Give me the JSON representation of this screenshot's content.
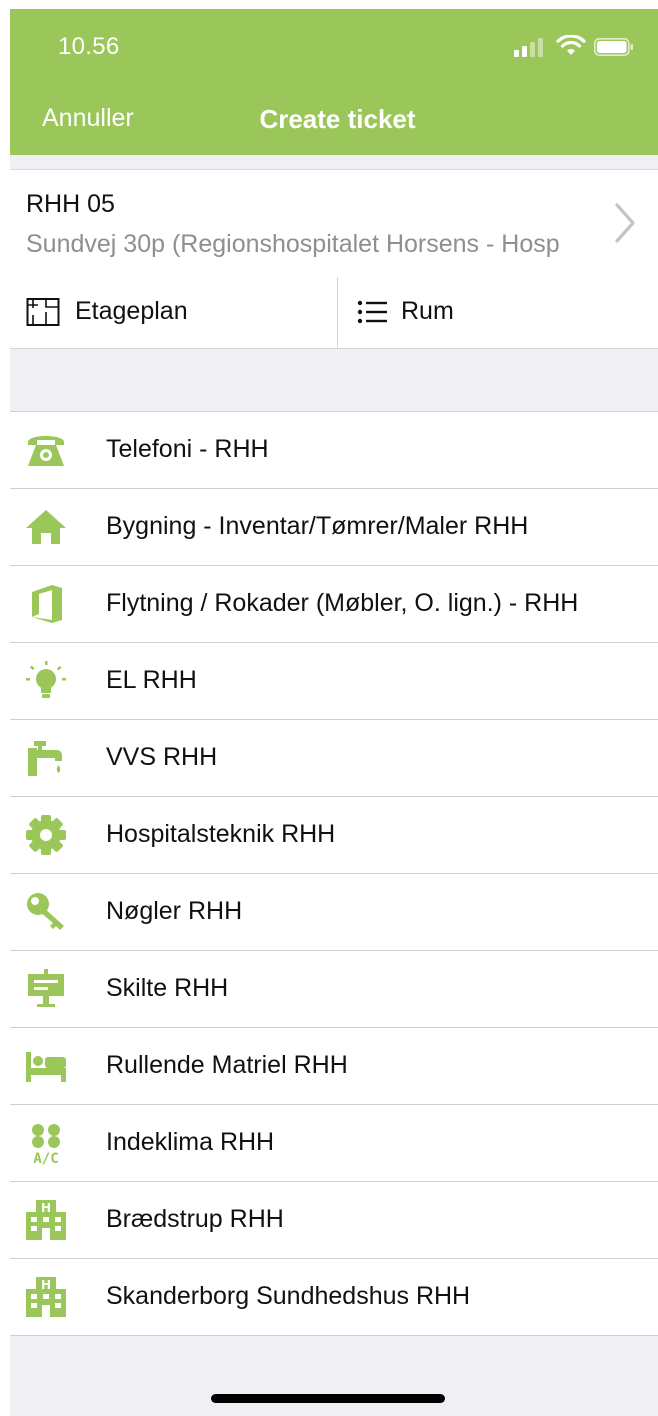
{
  "status_bar": {
    "time": "10.56"
  },
  "nav": {
    "cancel_label": "Annuller",
    "title": "Create ticket"
  },
  "location": {
    "title": "RHH 05",
    "subtitle": "Sundvej 30p (Regionshospitalet Horsens - Hosp"
  },
  "segments": {
    "floorplan_label": "Etageplan",
    "rooms_label": "Rum"
  },
  "accent_color": "#9bc659",
  "categories": [
    {
      "label": "Telefoni - RHH",
      "icon": "phone-icon"
    },
    {
      "label": "Bygning - Inventar/Tømrer/Maler RHH",
      "icon": "home-icon"
    },
    {
      "label": "Flytning / Rokader (Møbler, O. lign.) - RHH",
      "icon": "office-icon"
    },
    {
      "label": "EL RHH",
      "icon": "lightbulb-icon"
    },
    {
      "label": "VVS RHH",
      "icon": "faucet-icon"
    },
    {
      "label": "Hospitalsteknik RHH",
      "icon": "gear-icon"
    },
    {
      "label": "Nøgler RHH",
      "icon": "key-icon"
    },
    {
      "label": "Skilte RHH",
      "icon": "signboard-icon"
    },
    {
      "label": "Rullende Matriel RHH",
      "icon": "bed-icon"
    },
    {
      "label": "Indeklima RHH",
      "icon": "air-conditioner-icon",
      "icon_text": "A/C"
    },
    {
      "label": "Brædstrup RHH",
      "icon": "hospital-icon",
      "icon_text": "H"
    },
    {
      "label": "Skanderborg Sundhedshus RHH",
      "icon": "hospital-icon",
      "icon_text": "H"
    }
  ]
}
